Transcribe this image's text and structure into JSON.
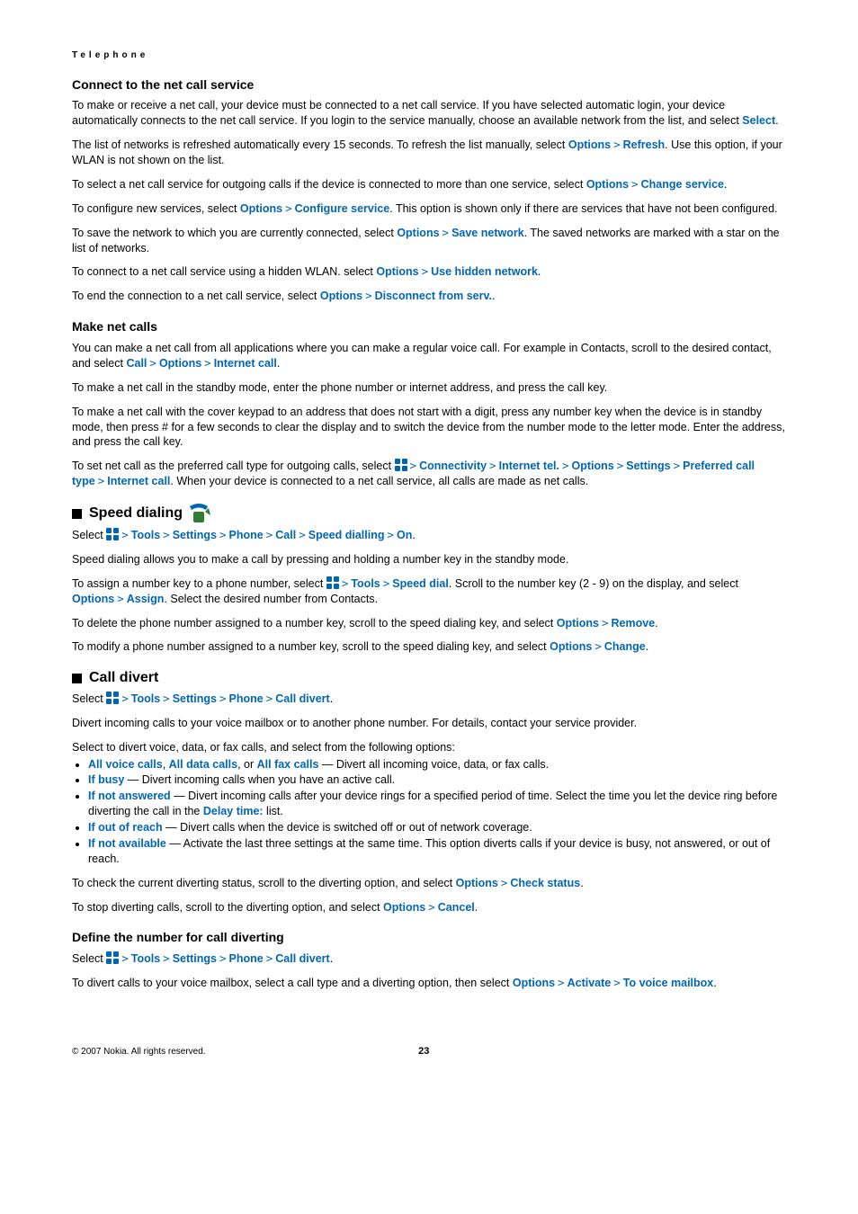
{
  "chapter": "Telephone",
  "s1": {
    "title": "Connect to the net call service",
    "p1a": "To make or receive a net call, your device must be connected to a net call service. If you have selected automatic login, your device automatically connects to the net call service. If you login to the service manually, choose an available network from the list, and select ",
    "select": "Select",
    "p2a": "The list of networks is refreshed automatically every 15 seconds. To refresh the list manually, select ",
    "options": "Options",
    "refresh": "Refresh",
    "p2b": ". Use this option, if your WLAN is not shown on the list.",
    "p3a": "To select a net call service for outgoing calls if the device is connected to more than one service, select ",
    "change_service": "Change service",
    "p4a": "To configure new services, select ",
    "configure_service": "Configure service",
    "p4b": ". This option is shown only if there are services that have not been configured.",
    "p5a": "To save the network to which you are currently connected, select ",
    "save_network": "Save network",
    "p5b": ". The saved networks are marked with a star on the list of networks.",
    "p6a": "To connect to a net call service using a hidden WLAN. select ",
    "use_hidden": "Use hidden network",
    "p7a": "To end the connection to a net call service, select ",
    "disconnect": "Disconnect from serv."
  },
  "s2": {
    "title": "Make net calls",
    "p1a": "You can make a net call from all applications where you can make a regular voice call. For example in Contacts, scroll to the desired contact, and select ",
    "call": "Call",
    "options": "Options",
    "internet_call": "Internet call",
    "p2": "To make a net call in the standby mode, enter the phone number or internet address, and press the call key.",
    "p3": "To make a net call with the cover keypad to an address that does not start with a digit, press any number key when the device is in standby mode, then press # for a few seconds to clear the display and to switch the device from the number mode to the letter mode. Enter the address, and press the call key.",
    "p4a": "To set net call as the preferred call type for outgoing calls, select ",
    "connectivity": "Connectivity",
    "internet_tel": "Internet tel.",
    "settings": "Settings",
    "preferred": "Preferred call type",
    "p4b": ". When your device is connected to a net call service, all calls are made as net calls."
  },
  "s3": {
    "title": "Speed dialing",
    "nav": {
      "select": "Select ",
      "tools": "Tools",
      "settings": "Settings",
      "phone": "Phone",
      "call": "Call",
      "speed_dialling": "Speed dialling",
      "on": "On"
    },
    "p1": "Speed dialing allows you to make a call by pressing and holding a number key in the standby mode.",
    "p2a": "To assign a number key to a phone number, select ",
    "speed_dial": "Speed dial",
    "p2b": ". Scroll to the number key (2 - 9) on the display, and select ",
    "options": "Options",
    "assign": "Assign",
    "p2c": ". Select the desired number from Contacts.",
    "p3a": "To delete the phone number assigned to a number key, scroll to the speed dialing key, and select ",
    "remove": "Remove",
    "p4a": "To modify a phone number assigned to a number key, scroll to the speed dialing key, and select ",
    "change": "Change"
  },
  "s4": {
    "title": "Call divert",
    "nav": {
      "select": "Select ",
      "tools": "Tools",
      "settings": "Settings",
      "phone": "Phone",
      "call_divert": "Call divert"
    },
    "p1": "Divert incoming calls to your voice mailbox or to another phone number. For details, contact your service provider.",
    "p2": "Select to divert voice, data, or fax calls, and select from the following options:",
    "li1": {
      "a": "All voice calls",
      "b": "All data calls",
      "or": ", or ",
      "c": "All fax calls",
      "txt": " — Divert all incoming voice, data, or fax calls."
    },
    "li2": {
      "a": "If busy",
      "txt": " — Divert incoming calls when you have an active call."
    },
    "li3": {
      "a": "If not answered",
      "txt1": " — Divert incoming calls after your device rings for a specified period of time. Select the time you let the device ring before diverting the call in the ",
      "b": "Delay time:",
      "txt2": " list."
    },
    "li4": {
      "a": "If out of reach",
      "txt": " — Divert calls when the device is switched off or out of network coverage."
    },
    "li5": {
      "a": "If not available",
      "txt": " — Activate the last three settings at the same time. This option diverts calls if your device is busy, not answered, or out of reach."
    },
    "p3a": "To check the current diverting status, scroll to the diverting option, and select ",
    "options": "Options",
    "check_status": "Check status",
    "p4a": "To stop diverting calls, scroll to the diverting option, and select ",
    "cancel": "Cancel"
  },
  "s5": {
    "title": "Define the number for call diverting",
    "nav": {
      "select": "Select ",
      "tools": "Tools",
      "settings": "Settings",
      "phone": "Phone",
      "call_divert": "Call divert"
    },
    "p1a": "To divert calls to your voice mailbox, select a call type and a diverting option, then select ",
    "options": "Options",
    "activate": "Activate",
    "to_voice": "To voice mailbox"
  },
  "footer": {
    "copyright": "© 2007 Nokia. All rights reserved.",
    "page": "23"
  },
  "gt": ">"
}
